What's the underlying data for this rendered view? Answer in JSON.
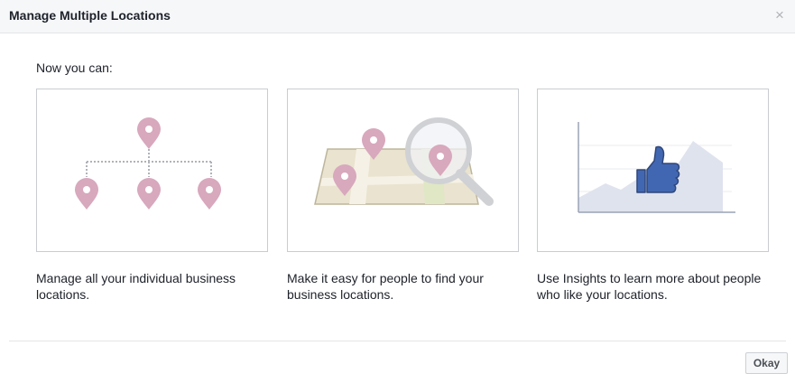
{
  "dialog": {
    "title": "Manage Multiple Locations",
    "close_glyph": "×",
    "intro": "Now you can:",
    "features": [
      {
        "icon": "location-hierarchy-icon",
        "description": "Manage all your individual business locations."
      },
      {
        "icon": "map-search-icon",
        "description": "Make it easy for people to find your business locations."
      },
      {
        "icon": "insights-like-chart-icon",
        "description": "Use Insights to learn more about people who like your locations."
      }
    ],
    "ok_label": "Okay"
  },
  "colors": {
    "pin": "#d8a8bd",
    "brand_blue": "#4267b2",
    "header_bg": "#f6f7f9"
  }
}
